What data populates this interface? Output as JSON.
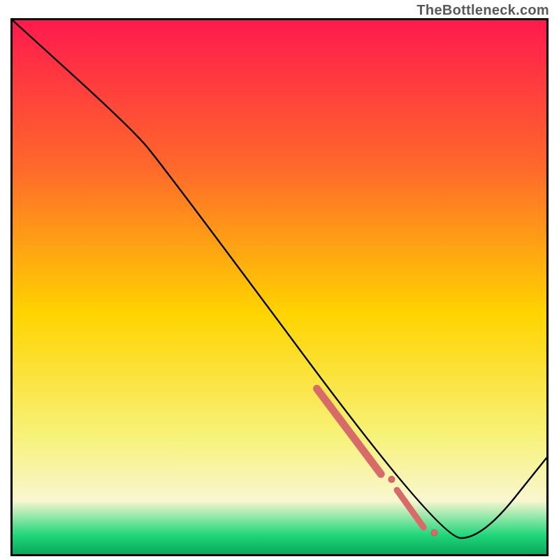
{
  "watermark": "TheBottleneck.com",
  "colors": {
    "frame": "#000000",
    "curve": "#000000",
    "marker_fill": "#d86a6a",
    "marker_stroke": "#c85a5a",
    "grad_top": "#ff1a4d",
    "grad_mid_upper": "#ff6a2a",
    "grad_mid": "#ffd400",
    "grad_mid_lower": "#f7f27a",
    "grad_pale": "#f9f6d0",
    "grad_green": "#1fd67a",
    "grad_green_deep": "#0aa85a"
  },
  "chart_data": {
    "type": "line",
    "title": "",
    "xlabel": "",
    "ylabel": "",
    "xlim": [
      0,
      100
    ],
    "ylim": [
      0,
      100
    ],
    "grid": false,
    "legend": false,
    "curve": [
      {
        "x": 0,
        "y": 100
      },
      {
        "x": 22,
        "y": 80
      },
      {
        "x": 28,
        "y": 73
      },
      {
        "x": 80,
        "y": 3
      },
      {
        "x": 88,
        "y": 3
      },
      {
        "x": 100,
        "y": 18
      }
    ],
    "highlight_segments": [
      {
        "x0": 57,
        "y0": 31,
        "x1": 69,
        "y1": 15,
        "width": 11
      },
      {
        "x0": 72,
        "y0": 12,
        "x1": 77,
        "y1": 5,
        "width": 9
      }
    ],
    "highlight_points": [
      {
        "x": 71,
        "y": 14,
        "r": 4.5
      },
      {
        "x": 79,
        "y": 4,
        "r": 4.5
      }
    ],
    "background_gradient_stops": [
      {
        "offset": 0.0,
        "key": "grad_top"
      },
      {
        "offset": 0.28,
        "key": "grad_mid_upper"
      },
      {
        "offset": 0.55,
        "key": "grad_mid"
      },
      {
        "offset": 0.78,
        "key": "grad_mid_lower"
      },
      {
        "offset": 0.9,
        "key": "grad_pale"
      },
      {
        "offset": 0.965,
        "key": "grad_green"
      },
      {
        "offset": 1.0,
        "key": "grad_green_deep"
      }
    ],
    "annotations": []
  }
}
